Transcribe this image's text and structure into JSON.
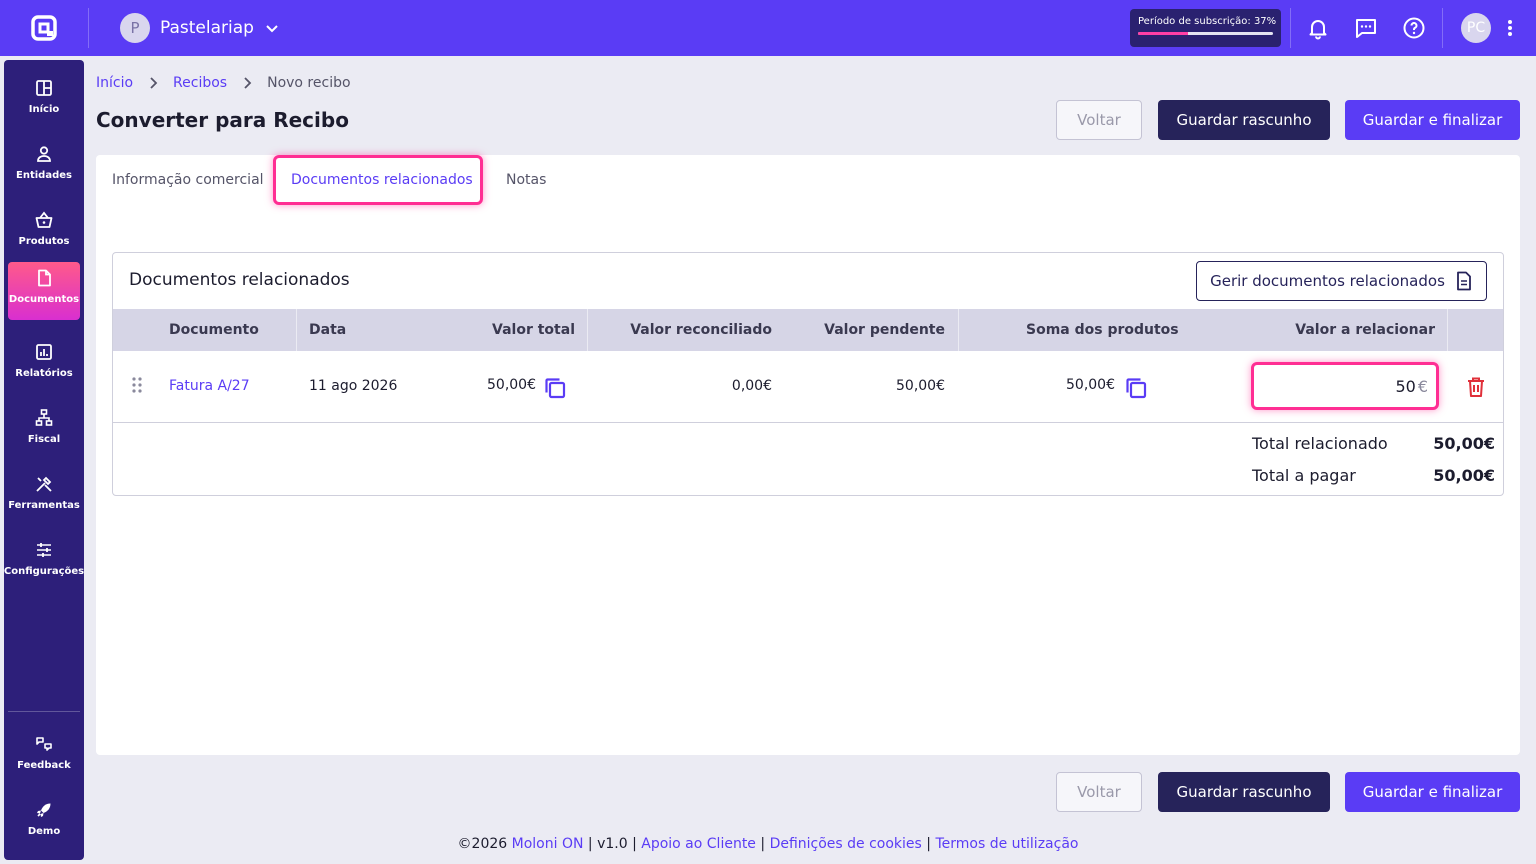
{
  "header": {
    "company_initial": "P",
    "company_name": "Pastelariap",
    "subscription_label": "Período de subscrição: 37%",
    "subscription_progress": 0.37,
    "user_initials": "PC"
  },
  "sidebar": {
    "items": [
      {
        "label": "Início",
        "icon": "grid-icon"
      },
      {
        "label": "Entidades",
        "icon": "person-icon"
      },
      {
        "label": "Produtos",
        "icon": "basket-icon"
      },
      {
        "label": "Documentos",
        "icon": "document-icon",
        "active": true
      },
      {
        "label": "Relatórios",
        "icon": "chart-icon"
      },
      {
        "label": "Fiscal",
        "icon": "tree-icon"
      },
      {
        "label": "Ferramentas",
        "icon": "tools-icon"
      },
      {
        "label": "Configurações",
        "icon": "sliders-icon"
      },
      {
        "label": "Feedback",
        "icon": "feedback-icon"
      },
      {
        "label": "Demo",
        "icon": "rocket-icon"
      }
    ]
  },
  "breadcrumb": {
    "home": "Início",
    "section": "Recibos",
    "current": "Novo recibo"
  },
  "page": {
    "title": "Converter para Recibo"
  },
  "actions": {
    "back": "Voltar",
    "save_draft": "Guardar rascunho",
    "save_finalize": "Guardar e finalizar"
  },
  "tabs": [
    {
      "label": "Informação comercial"
    },
    {
      "label": "Documentos relacionados",
      "active": true
    },
    {
      "label": "Notas"
    }
  ],
  "related": {
    "title": "Documentos relacionados",
    "manage_button": "Gerir documentos relacionados",
    "columns": [
      "Documento",
      "Data",
      "Valor total",
      "Valor reconciliado",
      "Valor pendente",
      "Soma dos produtos",
      "Valor a relacionar"
    ],
    "rows": [
      {
        "document": "Fatura A/27",
        "date": "11 ago 2026",
        "total": "50,00€",
        "reconciled": "0,00€",
        "pending": "50,00€",
        "products_sum": "50,00€",
        "value_to_relate": "50",
        "currency": "€"
      }
    ],
    "total_related_label": "Total relacionado",
    "total_related_value": "50,00€",
    "total_to_pay_label": "Total a pagar",
    "total_to_pay_value": "50,00€"
  },
  "footer": {
    "copyright": "©2026",
    "brand": "Moloni ON",
    "version": "v1.0",
    "support": "Apoio ao Cliente",
    "cookies": "Definições de cookies",
    "terms": "Termos de utilização",
    "sep": "|"
  },
  "colors": {
    "primary": "#5a3cf5",
    "dark": "#26235a",
    "sidebar": "#2d1f7a",
    "highlight": "#ff2e93",
    "danger": "#e0303a"
  }
}
